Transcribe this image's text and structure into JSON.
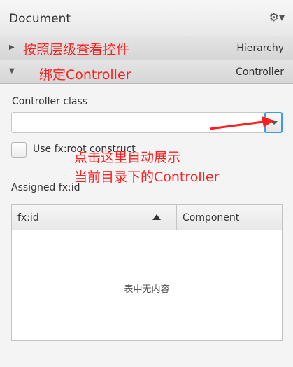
{
  "panel": {
    "title": "Document",
    "gear_icon": "gear-icon"
  },
  "sections": {
    "hierarchy": {
      "label": "Hierarchy",
      "annotation": "按照层级查看控件"
    },
    "controller": {
      "label": "Controller",
      "annotation": "绑定Controller"
    }
  },
  "controller": {
    "class_label": "Controller class",
    "class_value": "",
    "use_root_label": "Use fx:root construct",
    "use_root_checked": false,
    "annotation_line1": "点击这里自动展示",
    "annotation_line2": "当前目录下的Controller"
  },
  "assigned": {
    "label": "Assigned fx:id",
    "columns": [
      "fx:id",
      "Component"
    ],
    "rows": [],
    "empty_text": "表中无内容"
  },
  "colors": {
    "annotation": "#ff1f1f",
    "focus_border": "#3d9be9"
  }
}
